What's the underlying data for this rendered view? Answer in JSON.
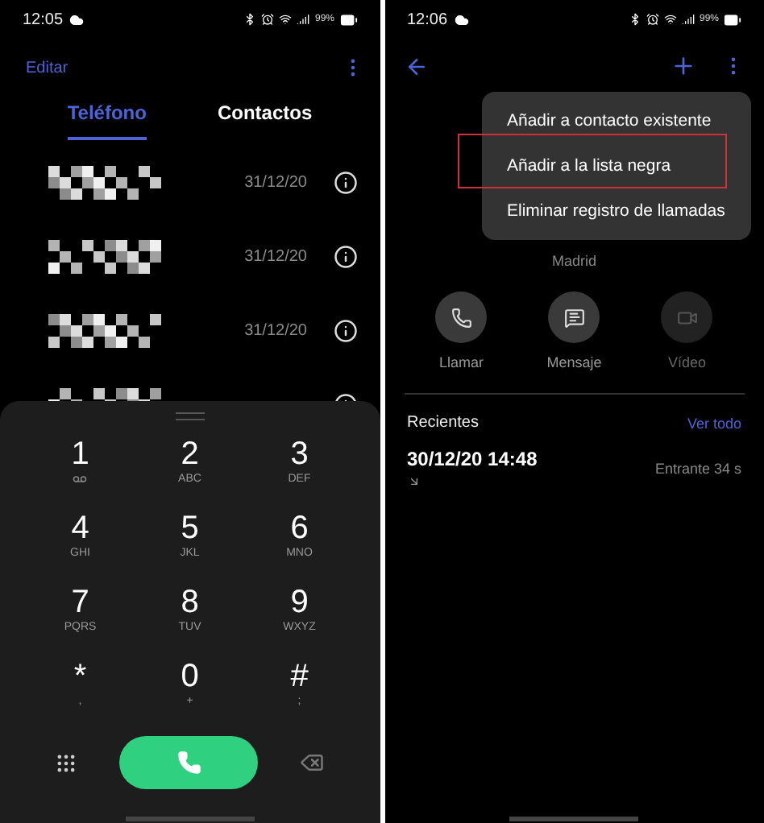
{
  "left_screen": {
    "status_bar": {
      "time": "12:05",
      "battery": "99%"
    },
    "header": {
      "action": "Editar"
    },
    "tabs": [
      {
        "label": "Teléfono",
        "selected": true
      },
      {
        "label": "Contactos",
        "selected": false
      }
    ],
    "calls": [
      {
        "kind": "full",
        "date": "31/12/20"
      },
      {
        "kind": "full",
        "date": "31/12/20"
      },
      {
        "kind": "full",
        "date": "31/12/20"
      },
      {
        "kind": "partial"
      }
    ],
    "keypad": [
      {
        "digit": "1",
        "kind": "voicemail"
      },
      {
        "digit": "2",
        "letters": "ABC",
        "kind": "letters"
      },
      {
        "digit": "3",
        "letters": "DEF",
        "kind": "letters"
      },
      {
        "digit": "4",
        "letters": "GHI",
        "kind": "letters"
      },
      {
        "digit": "5",
        "letters": "JKL",
        "kind": "letters"
      },
      {
        "digit": "6",
        "letters": "MNO",
        "kind": "letters"
      },
      {
        "digit": "7",
        "letters": "PQRS",
        "kind": "letters"
      },
      {
        "digit": "8",
        "letters": "TUV",
        "kind": "letters"
      },
      {
        "digit": "9",
        "letters": "WXYZ",
        "kind": "letters"
      },
      {
        "digit": "*",
        "letters": ",",
        "kind": "letters"
      },
      {
        "digit": "0",
        "letters": "+",
        "kind": "letters"
      },
      {
        "digit": "#",
        "letters": ";",
        "kind": "letters"
      }
    ]
  },
  "right_screen": {
    "status_bar": {
      "time": "12:06",
      "battery": "99%"
    },
    "menu": [
      {
        "label": "Añadir a contacto existente",
        "marked": false
      },
      {
        "label": "Añadir a la lista negra",
        "marked": true
      },
      {
        "label": "Eliminar registro de llamadas",
        "marked": false
      }
    ],
    "contact": {
      "location": "Madrid"
    },
    "actions": [
      {
        "label": "Llamar",
        "kind": "call",
        "disabled": false
      },
      {
        "label": "Mensaje",
        "kind": "message",
        "disabled": false
      },
      {
        "label": "Vídeo",
        "kind": "video",
        "disabled": true
      }
    ],
    "recents": {
      "title": "Recientes",
      "link": "Ver todo",
      "entries": [
        {
          "datetime": "30/12/20 14:48",
          "type": "Entrante",
          "duration": "34 s"
        }
      ]
    }
  }
}
